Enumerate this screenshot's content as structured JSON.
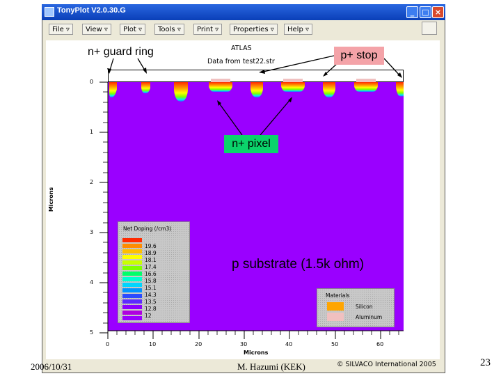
{
  "window": {
    "title": "TonyPlot V2.0.30.G",
    "buttons": {
      "minimize": "_",
      "maximize": "□",
      "close": "×"
    }
  },
  "menu": {
    "items": [
      {
        "label": "File ▿"
      },
      {
        "label": "View ▿"
      },
      {
        "label": "Plot ▿"
      },
      {
        "label": "Tools ▿"
      },
      {
        "label": "Print ▿"
      },
      {
        "label": "Properties ▿"
      },
      {
        "label": "Help ▿"
      }
    ]
  },
  "plot": {
    "title": "ATLAS",
    "subtitle": "Data from test22.str",
    "xlabel": "Microns",
    "ylabel": "Microns",
    "x_ticks": [
      "0",
      "10",
      "20",
      "30",
      "40",
      "50",
      "60"
    ],
    "y_ticks": [
      "0",
      "1",
      "2",
      "3",
      "4",
      "5"
    ],
    "xlim": [
      0,
      65
    ],
    "ylim": [
      0,
      5
    ],
    "substrate_color": "#9a00ff",
    "oxide_color": "#ffffff"
  },
  "legend": {
    "title": "Net Doping (/cm3)",
    "values": [
      "19.6",
      "18.9",
      "18.1",
      "17.4",
      "16.6",
      "15.8",
      "15.1",
      "14.3",
      "13.5",
      "12.8",
      "12"
    ]
  },
  "materials": {
    "title": "Materials",
    "items": [
      {
        "label": "Silicon",
        "color": "#ffa500"
      },
      {
        "label": "Aluminum",
        "color": "#f0c0c0"
      }
    ]
  },
  "annotations": {
    "guard_ring": "n+ guard ring",
    "p_stop": "p+ stop",
    "n_pixel": "n+ pixel",
    "substrate": "p substrate (1.5k ohm)"
  },
  "status": {
    "copyright": "© SILVACO International 2005"
  },
  "footer": {
    "date": "2006/10/31",
    "author": "M. Hazumi (KEK)",
    "page": "23"
  }
}
